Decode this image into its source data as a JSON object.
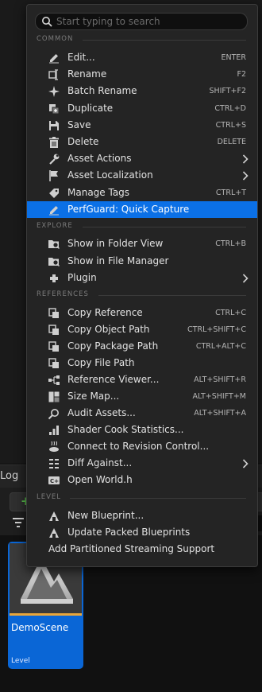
{
  "search": {
    "placeholder": "Start typing to search",
    "value": ""
  },
  "sections": {
    "common": "COMMON",
    "explore": "EXPLORE",
    "references": "REFERENCES",
    "level": "LEVEL"
  },
  "common_items": [
    {
      "label": "Edit...",
      "shortcut": "ENTER",
      "icon": "pencil-icon"
    },
    {
      "label": "Rename",
      "shortcut": "F2",
      "icon": "rename-icon"
    },
    {
      "label": "Batch Rename",
      "shortcut": "SHIFT+F2",
      "icon": "batch-rename-icon"
    },
    {
      "label": "Duplicate",
      "shortcut": "CTRL+D",
      "icon": "duplicate-icon"
    },
    {
      "label": "Save",
      "shortcut": "CTRL+S",
      "icon": "save-icon"
    },
    {
      "label": "Delete",
      "shortcut": "DELETE",
      "icon": "trash-icon"
    },
    {
      "label": "Asset Actions",
      "shortcut": "",
      "icon": "wrench-icon",
      "submenu": true
    },
    {
      "label": "Asset Localization",
      "shortcut": "",
      "icon": "flag-icon",
      "submenu": true
    },
    {
      "label": "Manage Tags",
      "shortcut": "CTRL+T",
      "icon": "tag-icon"
    },
    {
      "label": "PerfGuard: Quick Capture",
      "shortcut": "",
      "icon": "pencil-icon",
      "highlighted": true
    }
  ],
  "explore_items": [
    {
      "label": "Show in Folder View",
      "shortcut": "CTRL+B",
      "icon": "folder-search-icon"
    },
    {
      "label": "Show in File Manager",
      "shortcut": "",
      "icon": "folder-search-icon"
    },
    {
      "label": "Plugin",
      "shortcut": "",
      "icon": "plugin-icon",
      "submenu": true
    }
  ],
  "reference_items": [
    {
      "label": "Copy Reference",
      "shortcut": "CTRL+C",
      "icon": "copy-icon"
    },
    {
      "label": "Copy Object Path",
      "shortcut": "CTRL+SHIFT+C",
      "icon": "copy-icon"
    },
    {
      "label": "Copy Package Path",
      "shortcut": "CTRL+ALT+C",
      "icon": "copy-icon"
    },
    {
      "label": "Copy File Path",
      "shortcut": "",
      "icon": "copy-icon"
    },
    {
      "label": "Reference Viewer...",
      "shortcut": "ALT+SHIFT+R",
      "icon": "reference-viewer-icon"
    },
    {
      "label": "Size Map...",
      "shortcut": "ALT+SHIFT+M",
      "icon": "size-map-icon"
    },
    {
      "label": "Audit Assets...",
      "shortcut": "ALT+SHIFT+A",
      "icon": "audit-icon"
    },
    {
      "label": "Shader Cook Statistics...",
      "shortcut": "",
      "icon": "shader-stats-icon"
    },
    {
      "label": "Connect to Revision Control...",
      "shortcut": "",
      "icon": "revision-control-icon"
    },
    {
      "label": "Diff Against...",
      "shortcut": "",
      "icon": "diff-icon",
      "submenu": true
    },
    {
      "label": "Open World.h",
      "shortcut": "",
      "icon": "cpp-file-icon"
    }
  ],
  "level_items": [
    {
      "label": "New Blueprint...",
      "shortcut": "",
      "icon": "blueprint-icon"
    },
    {
      "label": "Update Packed Blueprints",
      "shortcut": "",
      "icon": "blueprint-icon"
    },
    {
      "label": "Add Partitioned Streaming Support",
      "shortcut": "",
      "icon": ""
    }
  ],
  "background": {
    "tab_label": "Log",
    "add_button": "+",
    "asset": {
      "name": "DemoScene",
      "type": "Level"
    }
  },
  "colors": {
    "highlight": "#0b70e6",
    "menu_bg": "#242424",
    "asset_tile": "#0a66d6",
    "add_green": "#5ac24d",
    "asset_underline": "#e9a63a"
  }
}
